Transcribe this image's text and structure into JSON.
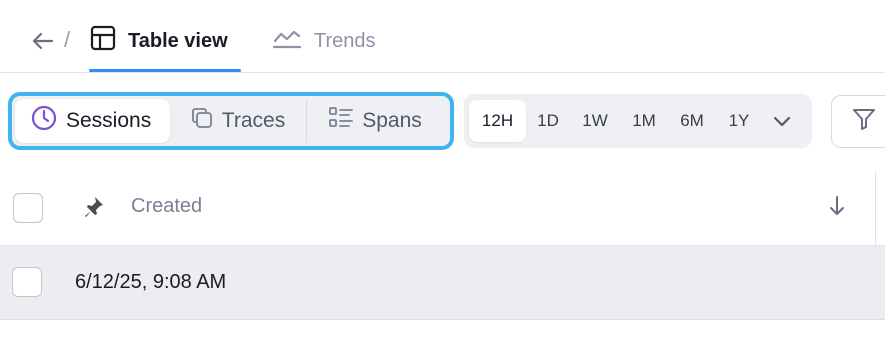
{
  "nav": {
    "separator": "/",
    "tabs": [
      {
        "label": "Table view",
        "icon": "table-icon",
        "active": true
      },
      {
        "label": "Trends",
        "icon": "trend-line-icon",
        "active": false
      }
    ]
  },
  "view_switch": {
    "options": [
      {
        "label": "Sessions",
        "icon": "clock-icon",
        "active": true
      },
      {
        "label": "Traces",
        "icon": "copy-icon",
        "active": false
      },
      {
        "label": "Spans",
        "icon": "list-icon",
        "active": false
      }
    ],
    "highlight_color": "#3fb5ee"
  },
  "time_range": {
    "options": [
      "12H",
      "1D",
      "1W",
      "1M",
      "6M",
      "1Y"
    ],
    "selected": "12H"
  },
  "table": {
    "columns": [
      {
        "label": "Created",
        "sort": "descending"
      }
    ],
    "rows": [
      {
        "created": "6/12/25, 9:08 AM"
      }
    ]
  },
  "colors": {
    "accent": "#2f8ff2",
    "sessions_icon": "#7b4fd6"
  }
}
